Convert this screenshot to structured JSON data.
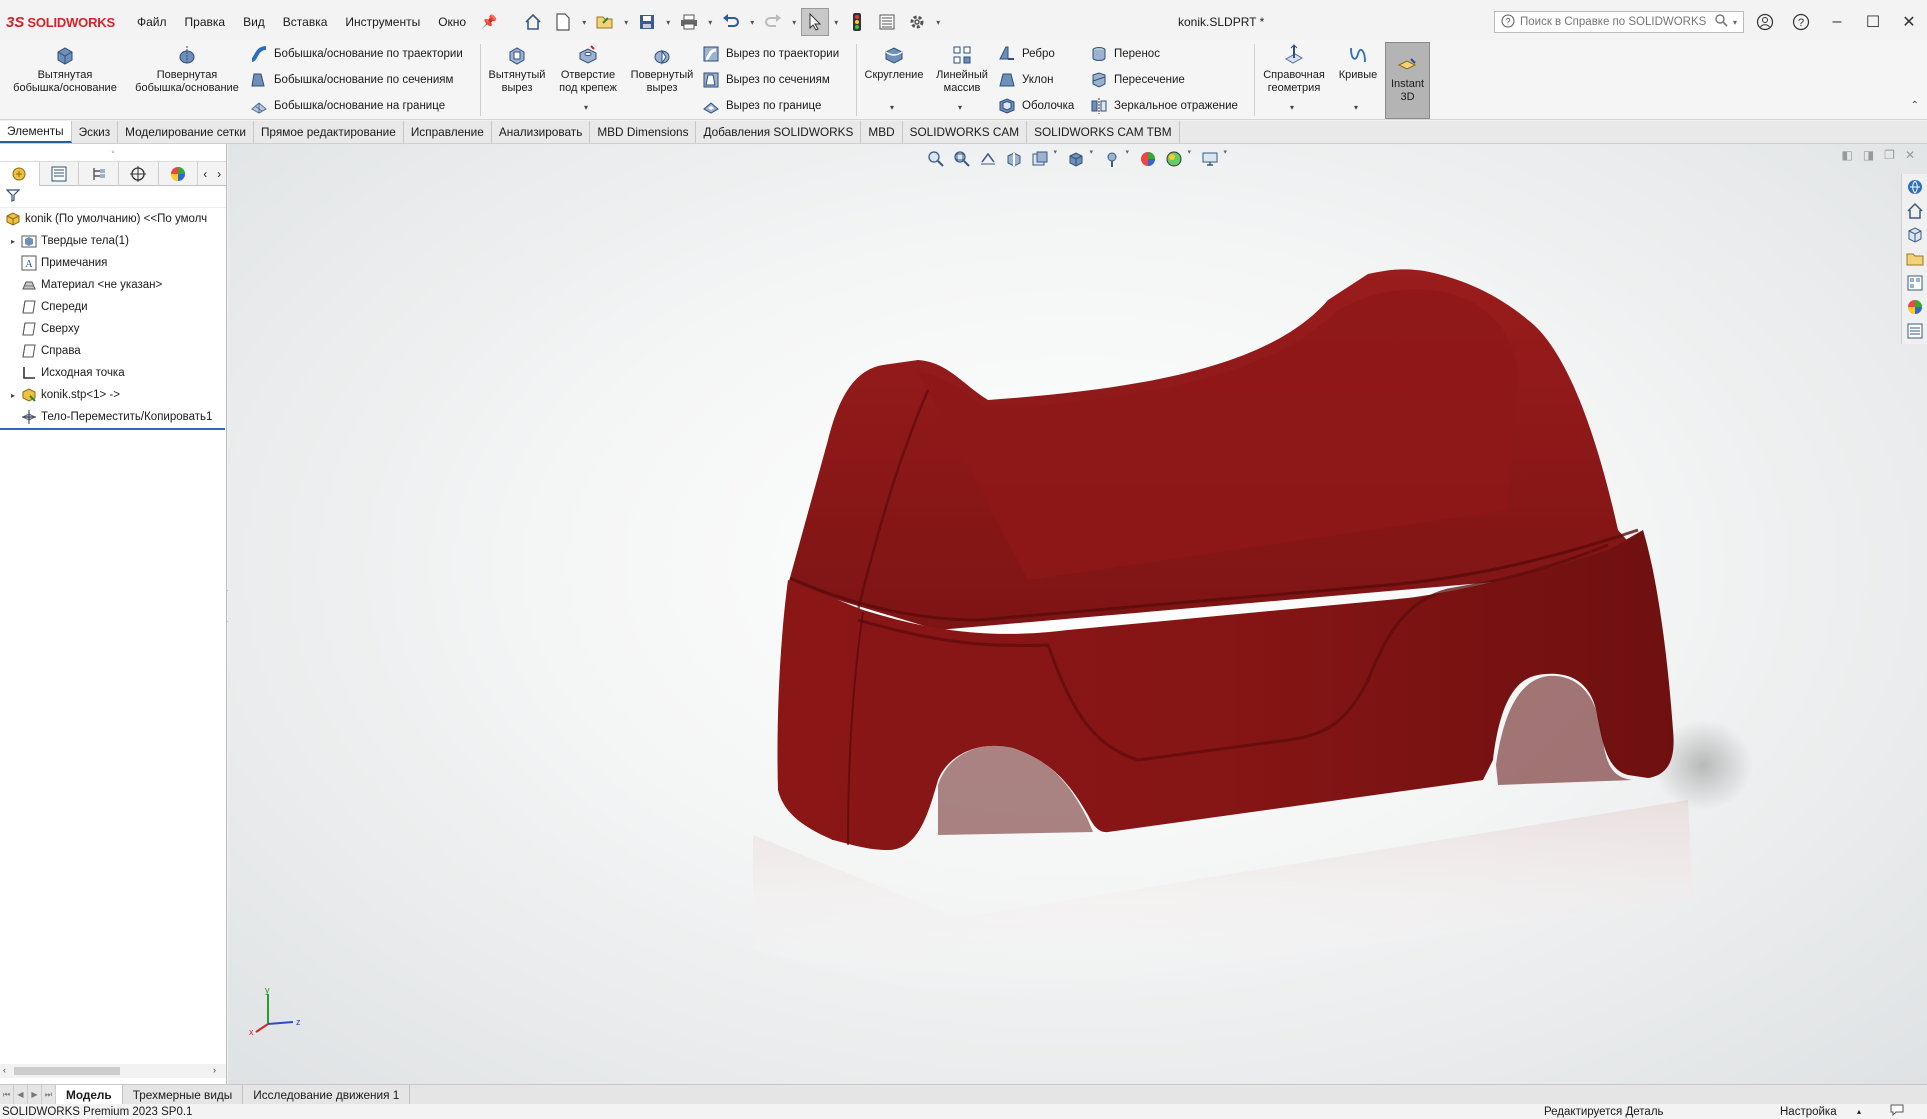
{
  "app": {
    "logo_ds": "3S",
    "logo_text": "SOLIDWORKS",
    "document_title": "konik.SLDPRT *"
  },
  "menu": [
    "Файл",
    "Правка",
    "Вид",
    "Вставка",
    "Инструменты",
    "Окно"
  ],
  "help_search": {
    "placeholder": "Поиск в Справке по SOLIDWORKS"
  },
  "ribbon": {
    "extruded_boss": "Вытянутая\nбобышка/основание",
    "revolved_boss": "Повернутая\nбобышка/основание",
    "swept_boss": "Бобышка/основание по траектории",
    "lofted_boss": "Бобышка/основание по сечениям",
    "boundary_boss": "Бобышка/основание на границе",
    "extruded_cut": "Вытянутый\nвырез",
    "hole_wizard": "Отверстие\nпод крепеж",
    "revolved_cut": "Повернутый\nвырез",
    "swept_cut": "Вырез по траектории",
    "lofted_cut": "Вырез по сечениям",
    "boundary_cut": "Вырез по границе",
    "fillet": "Скругление",
    "linear_pattern": "Линейный\nмассив",
    "rib": "Ребро",
    "draft": "Уклон",
    "shell": "Оболочка",
    "wrap": "Перенос",
    "intersect": "Пересечение",
    "mirror": "Зеркальное отражение",
    "reference_geometry": "Справочная\nгеометрия",
    "curves": "Кривые",
    "instant3d": "Instant\n3D"
  },
  "command_tabs": [
    {
      "label": "Элементы",
      "active": true
    },
    {
      "label": "Эскиз"
    },
    {
      "label": "Моделирование сетки"
    },
    {
      "label": "Прямое редактирование"
    },
    {
      "label": "Исправление"
    },
    {
      "label": "Анализировать"
    },
    {
      "label": "MBD Dimensions"
    },
    {
      "label": "Добавления SOLIDWORKS"
    },
    {
      "label": "MBD"
    },
    {
      "label": "SOLIDWORKS CAM"
    },
    {
      "label": "SOLIDWORKS CAM TBM"
    }
  ],
  "feature_tree": {
    "root": "konik (По умолчанию) <<По умолч",
    "items": [
      {
        "label": "Твердые тела(1)",
        "icon": "solid-bodies-icon",
        "expander": true
      },
      {
        "label": "Примечания",
        "icon": "annotations-icon",
        "expander": false
      },
      {
        "label": "Материал <не указан>",
        "icon": "material-icon",
        "expander": false
      },
      {
        "label": "Спереди",
        "icon": "plane-icon",
        "expander": false
      },
      {
        "label": "Сверху",
        "icon": "plane-icon",
        "expander": false
      },
      {
        "label": "Справа",
        "icon": "plane-icon",
        "expander": false
      },
      {
        "label": "Исходная точка",
        "icon": "origin-icon",
        "expander": false
      },
      {
        "label": "konik.stp<1> ->",
        "icon": "imported-part-icon",
        "expander": true
      },
      {
        "label": "Тело-Переместить/Копировать1",
        "icon": "move-copy-body-icon",
        "expander": false
      }
    ]
  },
  "bottom_tabs": [
    {
      "label": "Модель",
      "active": true
    },
    {
      "label": "Трехмерные виды"
    },
    {
      "label": "Исследование движения 1"
    }
  ],
  "status": {
    "product": "SOLIDWORKS Premium 2023 SP0.1",
    "mode": "Редактируется Деталь",
    "units": "Настройка"
  },
  "colors": {
    "model": "#8b1515",
    "model_dark": "#5a0b0b",
    "accent": "#2b5c9e",
    "brand": "#d2232a"
  },
  "triad": {
    "x": "x",
    "y": "y",
    "z": "z"
  }
}
